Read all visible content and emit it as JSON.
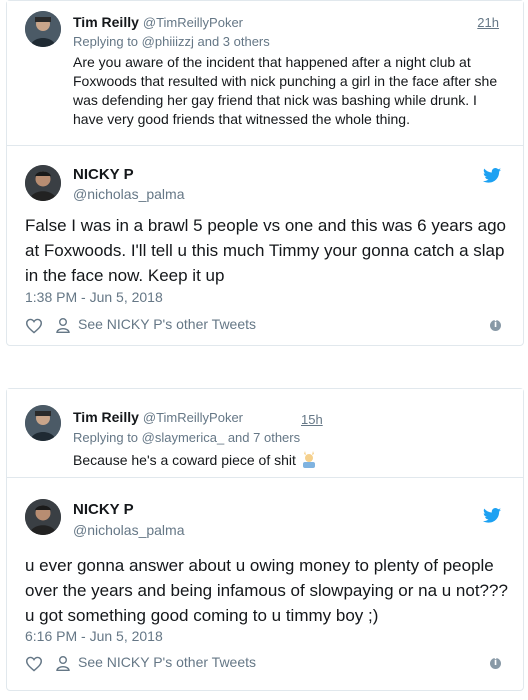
{
  "tweets": [
    {
      "quoted": {
        "name": "Tim Reilly",
        "handle": "@TimReillyPoker",
        "time": "21h",
        "replying_prefix": "Replying to ",
        "replying_to": "@phiiizzj",
        "replying_suffix": " and 3 others",
        "text": "Are you aware of the incident that happened after a night club at Foxwoods that resulted with nick punching a girl in the face after she was defending her gay friend that nick was bashing while drunk. I have very good friends that witnessed the whole thing."
      },
      "main": {
        "name": "NICKY P",
        "handle": "@nicholas_palma",
        "text": "False I was in a brawl 5 people vs one and this was 6 years ago at Foxwoods. I'll tell u this much Timmy your gonna catch a slap in the face now. Keep it up",
        "timestamp": "1:38 PM - Jun 5, 2018",
        "see_other": "See NICKY P's other Tweets"
      }
    },
    {
      "quoted": {
        "name": "Tim Reilly",
        "handle": "@TimReillyPoker",
        "time": "15h",
        "replying_prefix": "Replying to ",
        "replying_to": "@slaymerica_",
        "replying_suffix": " and 7 others",
        "text": "Because he's a coward piece of shit"
      },
      "main": {
        "name": "NICKY P",
        "handle": "@nicholas_palma",
        "text": "u ever gonna answer about u owing money to plenty of people over the years and being infamous of slowpaying or na u not??? u got something good coming to u timmy boy ;)",
        "timestamp": "6:16 PM - Jun 5, 2018",
        "see_other": "See NICKY P's other Tweets"
      }
    }
  ],
  "icons": {
    "bird": "twitter-bird-icon",
    "heart": "heart-icon",
    "person": "person-icon",
    "info": "info-icon"
  },
  "colors": {
    "twitter_blue": "#1da1f2",
    "secondary_text": "#657786",
    "border": "#e1e8ed"
  }
}
